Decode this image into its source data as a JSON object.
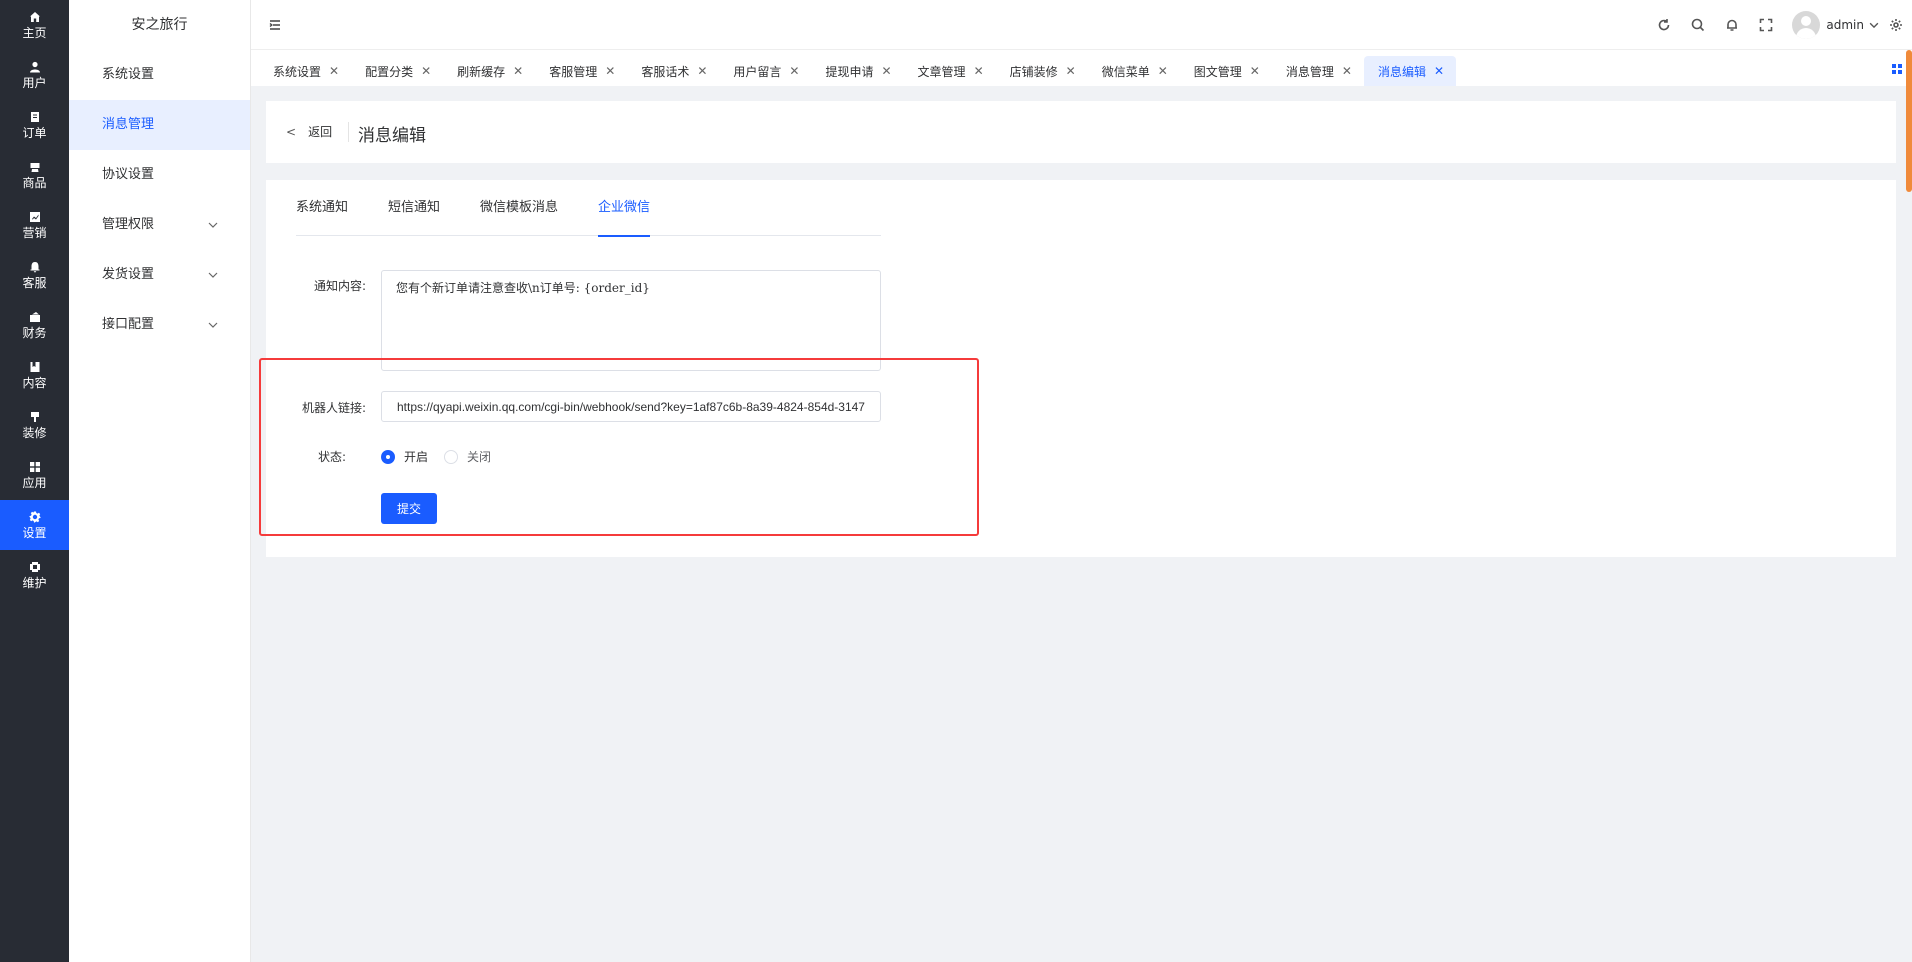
{
  "rail": {
    "items": [
      {
        "label": "主页",
        "icon": "home-icon"
      },
      {
        "label": "用户",
        "icon": "user-icon"
      },
      {
        "label": "订单",
        "icon": "order-icon"
      },
      {
        "label": "商品",
        "icon": "product-icon"
      },
      {
        "label": "营销",
        "icon": "marketing-icon"
      },
      {
        "label": "客服",
        "icon": "service-icon"
      },
      {
        "label": "财务",
        "icon": "finance-icon"
      },
      {
        "label": "内容",
        "icon": "content-icon"
      },
      {
        "label": "装修",
        "icon": "decorate-icon"
      },
      {
        "label": "应用",
        "icon": "apps-icon"
      },
      {
        "label": "设置",
        "icon": "settings-icon"
      },
      {
        "label": "维护",
        "icon": "maintain-icon"
      }
    ],
    "active_index": 10
  },
  "submenu": {
    "brand": "安之旅行",
    "items": [
      {
        "label": "系统设置"
      },
      {
        "label": "消息管理"
      },
      {
        "label": "协议设置"
      },
      {
        "label": "管理权限"
      },
      {
        "label": "发货设置"
      },
      {
        "label": "接口配置"
      }
    ]
  },
  "header": {
    "username": "admin"
  },
  "tabs": [
    {
      "label": "系统设置"
    },
    {
      "label": "配置分类"
    },
    {
      "label": "刷新缓存"
    },
    {
      "label": "客服管理"
    },
    {
      "label": "客服话术"
    },
    {
      "label": "用户留言"
    },
    {
      "label": "提现申请"
    },
    {
      "label": "文章管理"
    },
    {
      "label": "店铺装修"
    },
    {
      "label": "微信菜单"
    },
    {
      "label": "图文管理"
    },
    {
      "label": "消息管理"
    },
    {
      "label": "消息编辑"
    }
  ],
  "page": {
    "back_label": "返回",
    "title": "消息编辑"
  },
  "content_tabs": [
    {
      "label": "系统通知"
    },
    {
      "label": "短信通知"
    },
    {
      "label": "微信模板消息"
    },
    {
      "label": "企业微信"
    }
  ],
  "form": {
    "content_label": "通知内容:",
    "content_value": "您有个新订单请注意查收\\n订单号: {order_id}",
    "robot_label": "机器人链接:",
    "robot_value": "https://qyapi.weixin.qq.com/cgi-bin/webhook/send?key=1af87c6b-8a39-4824-854d-3147",
    "status_label": "状态:",
    "status_on": "开启",
    "status_off": "关闭",
    "submit_label": "提交"
  },
  "colors": {
    "primary": "#1a5cff",
    "rail_bg": "#282c34",
    "highlight": "#f53b3b"
  }
}
